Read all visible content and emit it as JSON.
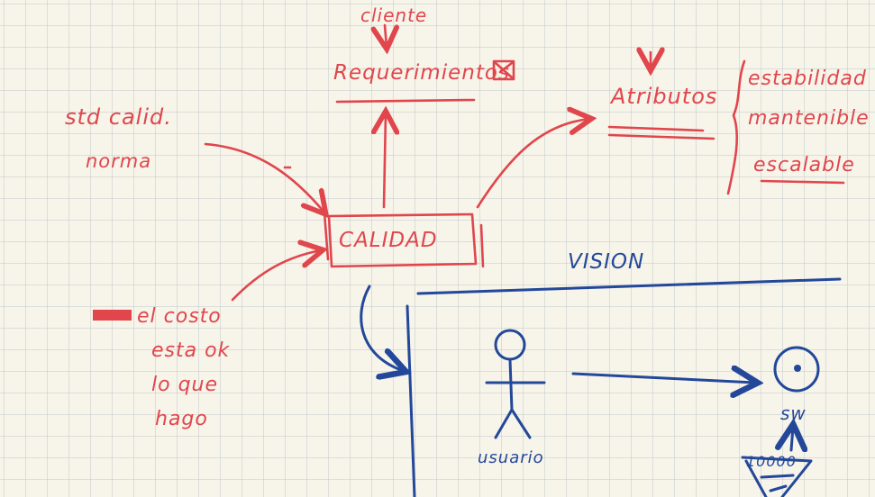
{
  "colors": {
    "background": "#f7f4ea",
    "grid": "#b9c3c8",
    "red_ink": "#e0464c",
    "blue_ink": "#23489a"
  },
  "labels": {
    "cliente": "cliente",
    "requerimientos": "Requerimientos",
    "atributos": "Atributos",
    "std_calid": "std calid.",
    "norma": "norma",
    "calidad": "CALIDAD",
    "attr_list": [
      "estabilidad",
      "mantenible",
      "escalable"
    ],
    "costo_lines": [
      "el costo",
      "esta ok",
      "lo que",
      "hago"
    ],
    "vision": "VISION",
    "usuario": "usuario",
    "sw": "sw",
    "count": "10000"
  }
}
